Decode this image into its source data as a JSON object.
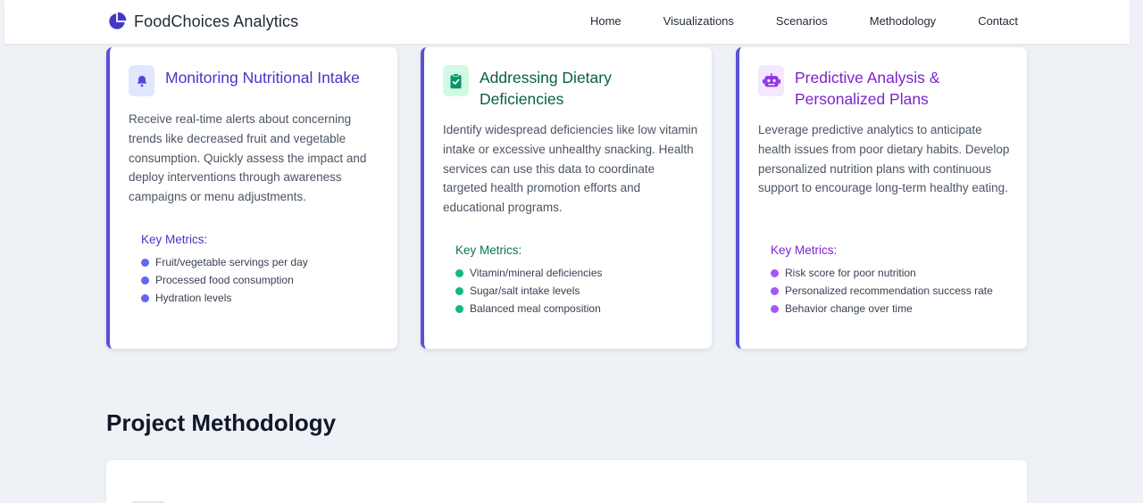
{
  "header": {
    "brand": "FoodChoices Analytics",
    "brand_icon": "pie-chart-icon",
    "nav": [
      "Home",
      "Visualizations",
      "Scenarios",
      "Methodology",
      "Contact"
    ]
  },
  "cards": [
    {
      "icon": "bell-icon",
      "title": "Monitoring Nutritional Intake",
      "description": "Receive real-time alerts about concerning trends like decreased fruit and vegetable consumption. Quickly assess the impact and deploy interventions through awareness campaigns or menu adjustments.",
      "metrics_title": "Key Metrics:",
      "metrics": [
        "Fruit/vegetable servings per day",
        "Processed food consumption",
        "Hydration levels"
      ]
    },
    {
      "icon": "clipboard-check-icon",
      "title": "Addressing Dietary Deficiencies",
      "description": "Identify widespread deficiencies like low vitamin intake or excessive unhealthy snacking. Health services can use this data to coordinate targeted health promotion efforts and educational programs.",
      "metrics_title": "Key Metrics:",
      "metrics": [
        "Vitamin/mineral deficiencies",
        "Sugar/salt intake levels",
        "Balanced meal composition"
      ]
    },
    {
      "icon": "robot-icon",
      "title": "Predictive Analysis & Personalized Plans",
      "description": "Leverage predictive analytics to anticipate health issues from poor dietary habits. Develop personalized nutrition plans with continuous support to encourage long-term healthy eating.",
      "metrics_title": "Key Metrics:",
      "metrics": [
        "Risk score for poor nutrition",
        "Personalized recommendation success rate",
        "Behavior change over time"
      ]
    }
  ],
  "methodology": {
    "title": "Project Methodology"
  },
  "colors": {
    "accent": "#5b4fd6",
    "indigo": "#4338ca",
    "green": "#065f46",
    "purple": "#7e22ce",
    "background": "#eef2f7"
  }
}
